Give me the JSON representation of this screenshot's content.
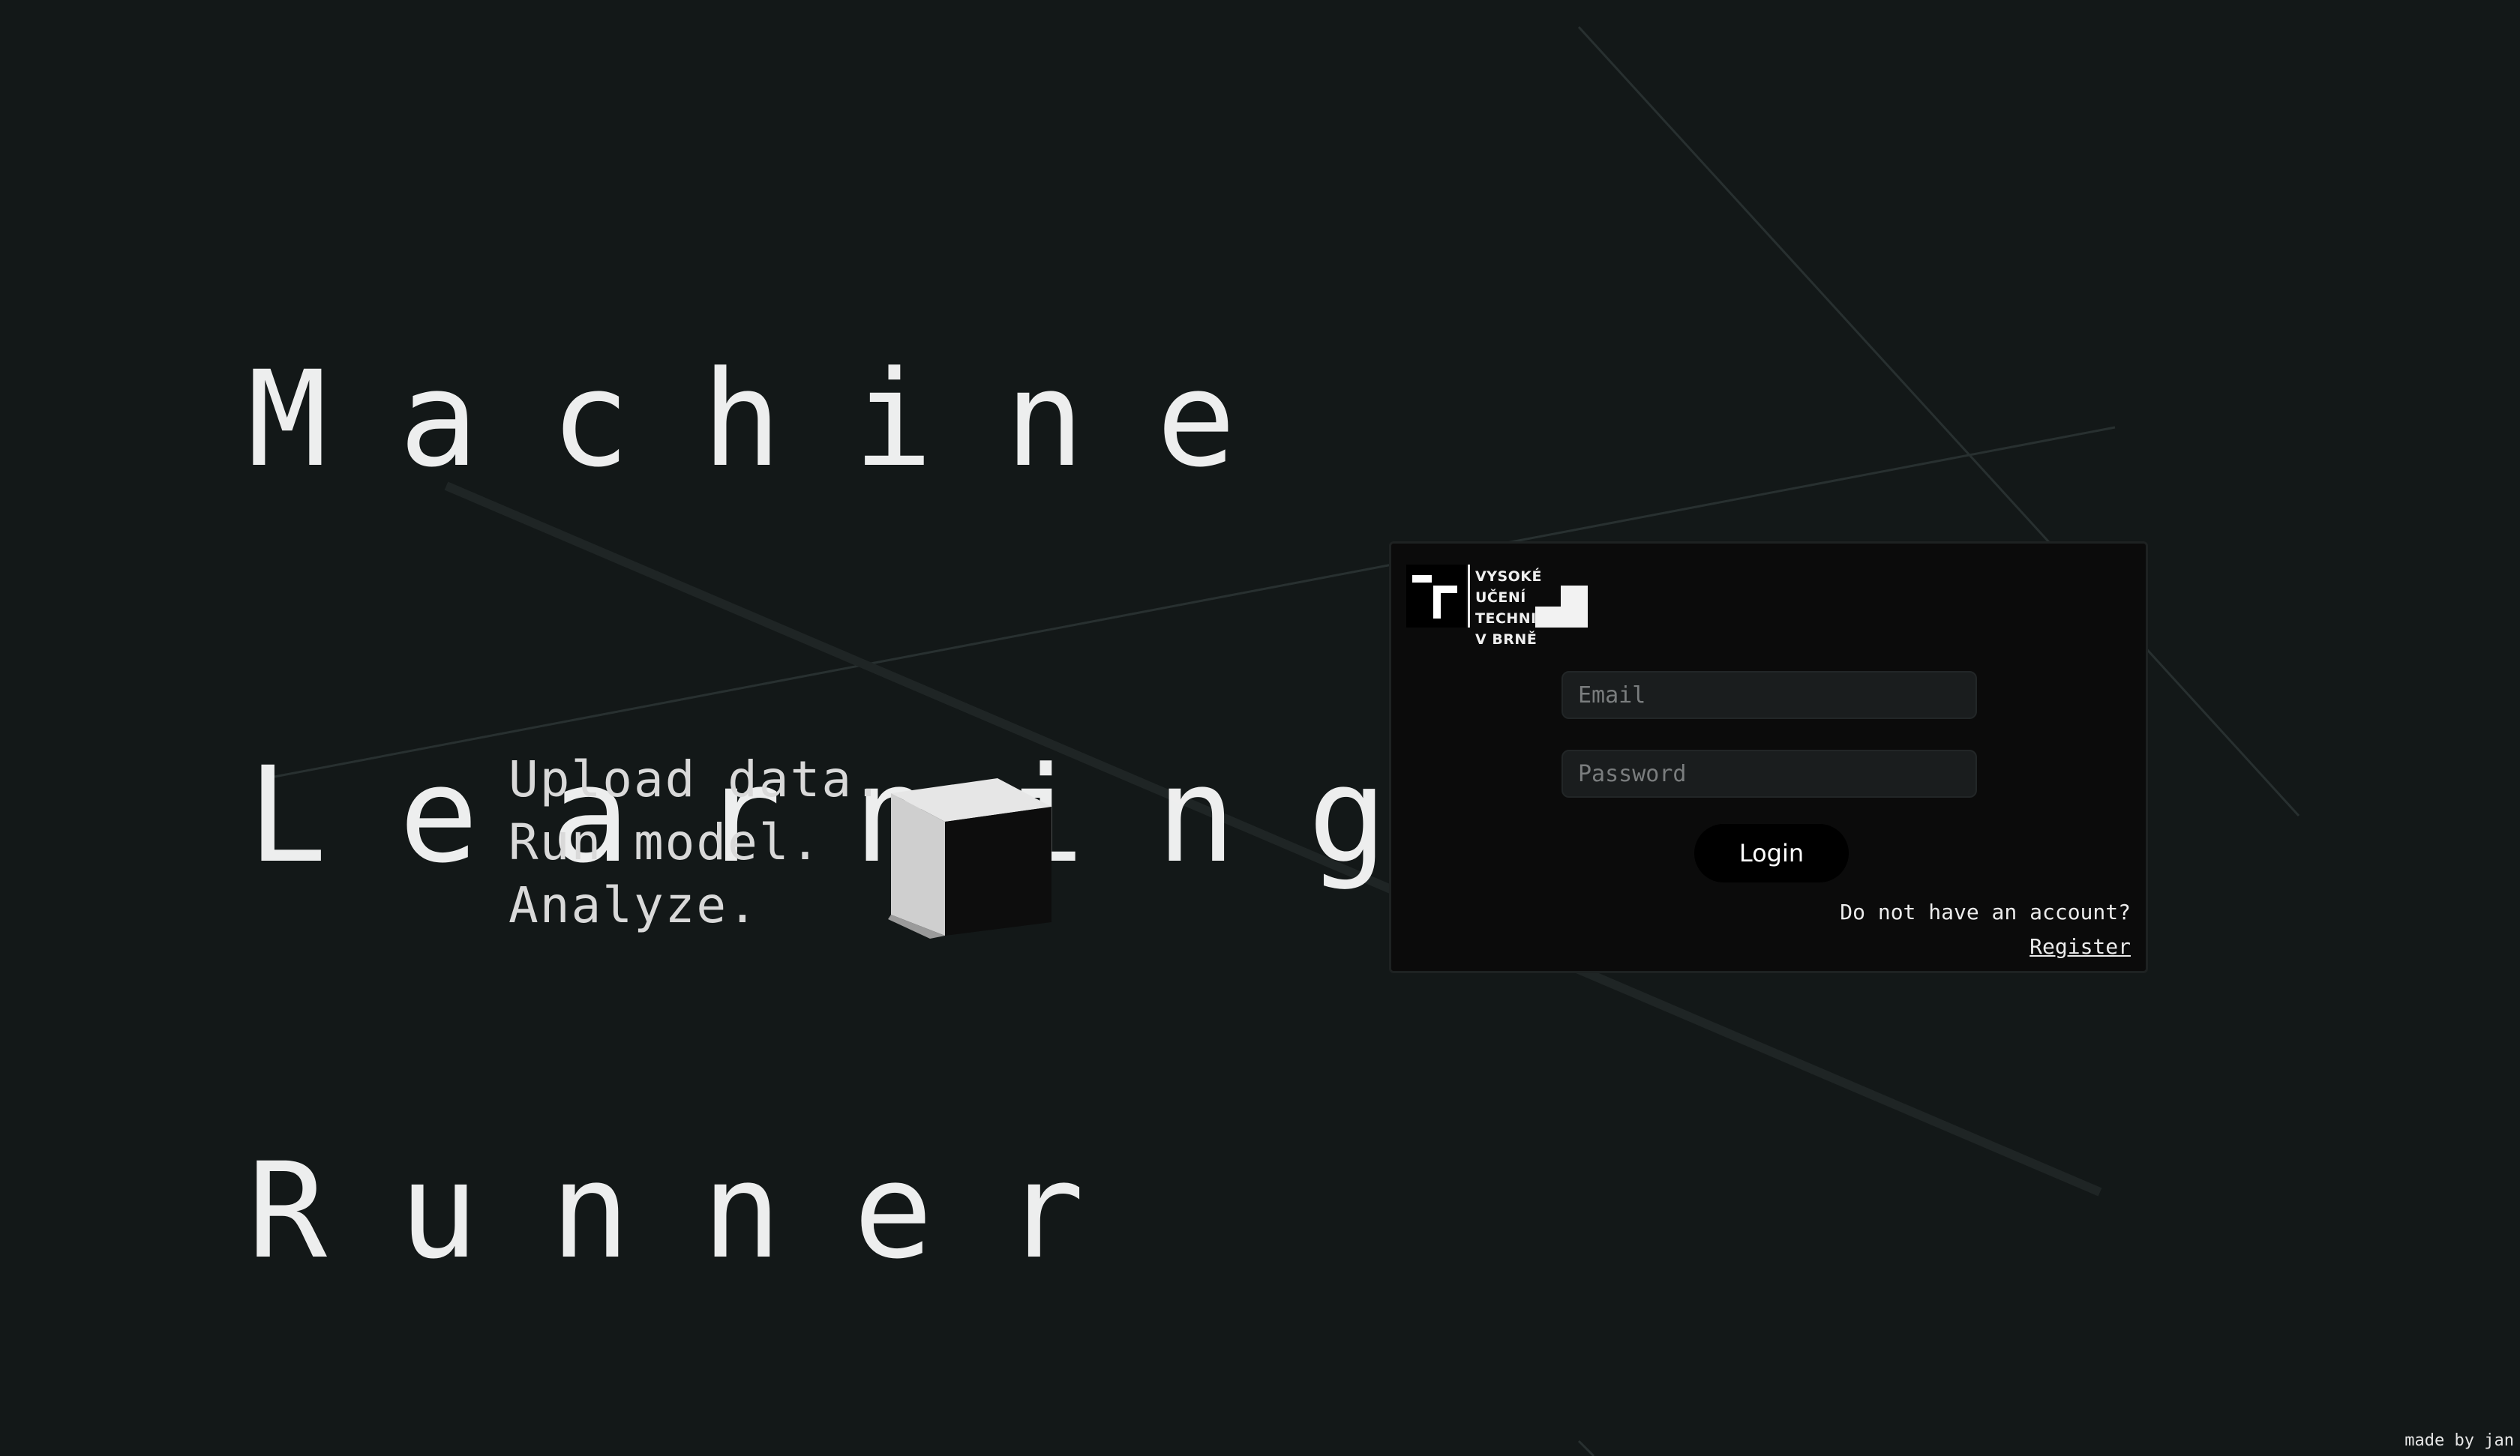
{
  "hero": {
    "line1": "Machine",
    "line2": "Learning",
    "line3": "Runner"
  },
  "tagline": {
    "line1": "Upload data.",
    "line2": "Run model.",
    "line3": "Analyze."
  },
  "logo": {
    "line1": "VYSOKÉ UČENÍ",
    "line2": "TECHNICKÉ",
    "line3": "V BRNĚ"
  },
  "login": {
    "email_placeholder": "Email",
    "password_placeholder": "Password",
    "button_label": "Login",
    "no_account_text": "Do not have an account?",
    "register_label": "Register"
  },
  "footer": {
    "credit": "made by jan"
  },
  "colors": {
    "background": "#131818",
    "card": "#0b0b0b",
    "input": "#1a1d1e",
    "button": "#000000",
    "text": "#f2f2f2"
  },
  "icons": {
    "cube": "cube-icon",
    "logo": "vut-logo"
  }
}
